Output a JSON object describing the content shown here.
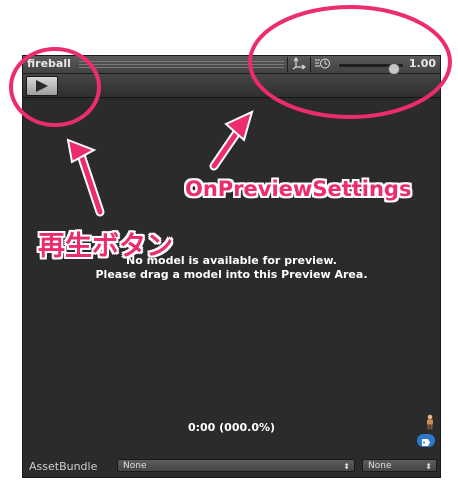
{
  "window": {
    "title": "fireball",
    "pivot_icon": "pivot-axis-icon",
    "speed_icon": "playback-speed-icon",
    "speed_value": "1.00",
    "speed_slider_level": 0.85
  },
  "toolbar": {
    "play_icon": "play-icon"
  },
  "preview": {
    "message_line1": "No model is available for preview.",
    "message_line2": "Please drag a model into this Preview Area.",
    "time": "0:00 (000.0%)",
    "avatar_icon": "avatar-figure-icon",
    "tag_icon": "tag-icon"
  },
  "bottom_bar": {
    "label": "AssetBundle",
    "bundle_value": "None",
    "variant_value": "None"
  },
  "annotations": {
    "play_label": "再生ボタン",
    "settings_label": "OnPreviewSettings",
    "color": "#ec2c6b"
  }
}
